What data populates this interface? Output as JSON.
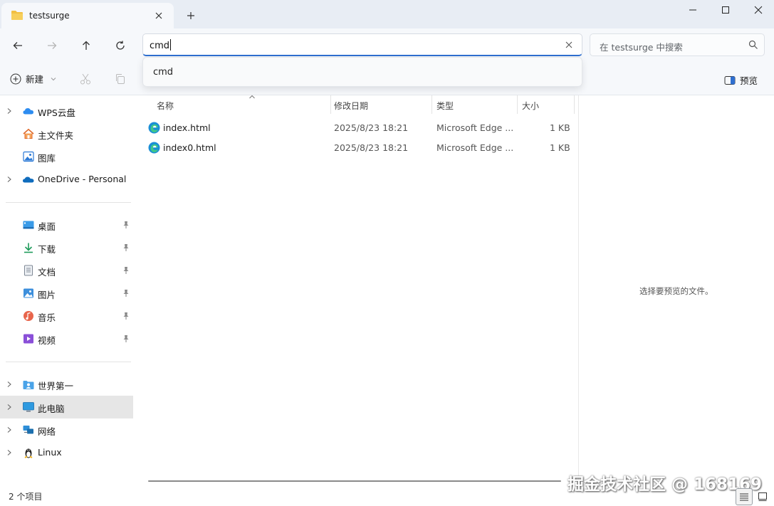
{
  "window": {
    "tab_title": "testsurge"
  },
  "navigation": {
    "address_value": "cmd",
    "search_placeholder": "在 testsurge 中搜索"
  },
  "suggestions": [
    "cmd"
  ],
  "toolbar": {
    "new_label": "新建",
    "preview_label": "预览"
  },
  "sidebar": {
    "group1": [
      {
        "label": "WPS云盘",
        "expandable": true,
        "icon": "cloud-icon"
      },
      {
        "label": "主文件夹",
        "expandable": false,
        "icon": "home-icon"
      },
      {
        "label": "图库",
        "expandable": false,
        "icon": "gallery-icon"
      },
      {
        "label": "OneDrive - Personal",
        "expandable": true,
        "icon": "onedrive-icon"
      }
    ],
    "quick_access": [
      {
        "label": "桌面",
        "icon": "desktop-icon"
      },
      {
        "label": "下载",
        "icon": "download-icon"
      },
      {
        "label": "文档",
        "icon": "document-icon"
      },
      {
        "label": "图片",
        "icon": "pictures-icon"
      },
      {
        "label": "音乐",
        "icon": "music-icon"
      },
      {
        "label": "视频",
        "icon": "video-icon"
      }
    ],
    "group3": [
      {
        "label": "世界第一",
        "icon": "user-folder-icon"
      },
      {
        "label": "此电脑",
        "icon": "computer-icon",
        "selected": true
      },
      {
        "label": "网络",
        "icon": "network-icon"
      },
      {
        "label": "Linux",
        "icon": "linux-icon"
      }
    ]
  },
  "files": {
    "columns": {
      "name": "名称",
      "date": "修改日期",
      "type": "类型",
      "size": "大小"
    },
    "rows": [
      {
        "name": "index.html",
        "date": "2025/8/23 18:21",
        "type": "Microsoft Edge ...",
        "size": "1 KB"
      },
      {
        "name": "index0.html",
        "date": "2025/8/23 18:21",
        "type": "Microsoft Edge ...",
        "size": "1 KB"
      }
    ]
  },
  "preview": {
    "message": "选择要预览的文件。"
  },
  "status": {
    "item_count": "2 个项目",
    "watermark": "掘金技术社区 @ 168169"
  },
  "colors": {
    "accent": "#2f6fd0",
    "folder": "#f2c043",
    "chrome": "#f6f8fb",
    "selected": "#e6e6e6"
  }
}
